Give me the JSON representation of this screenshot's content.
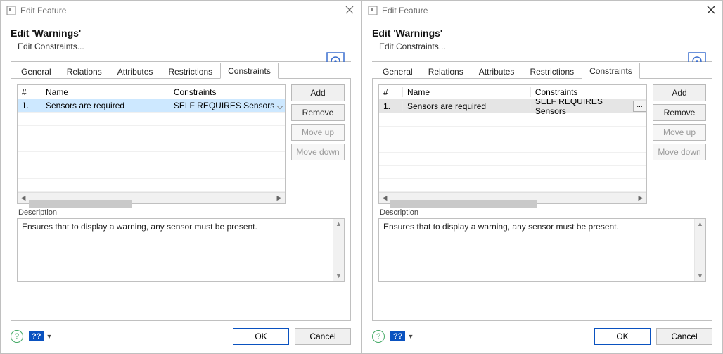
{
  "windows": [
    {
      "title": "Edit Feature",
      "heading": "Edit 'Warnings'",
      "breadcrumb": "Edit Constraints...",
      "row_selected_style": "blue",
      "show_ellipsis_in_row": false,
      "grid_thumb_width_pct": 42
    },
    {
      "title": "Edit Feature",
      "heading": "Edit 'Warnings'",
      "breadcrumb": "Edit Constraints...",
      "row_selected_style": "gray",
      "show_ellipsis_in_row": true,
      "grid_thumb_width_pct": 60
    }
  ],
  "tabs": [
    "General",
    "Relations",
    "Attributes",
    "Restrictions",
    "Constraints"
  ],
  "active_tab_index": 4,
  "columns": {
    "num": "#",
    "name": "Name",
    "constraints": "Constraints"
  },
  "rows": [
    {
      "num": "1.",
      "name": "Sensors are required",
      "constraints": "SELF REQUIRES Sensors"
    }
  ],
  "empty_row_count": 6,
  "buttons": {
    "add": "Add",
    "remove": "Remove",
    "moveup": "Move up",
    "movedown": "Move down"
  },
  "buttons_disabled": {
    "add": false,
    "remove": false,
    "moveup": true,
    "movedown": true
  },
  "description_label": "Description",
  "description_text": "Ensures that to display a warning, any sensor must be present.",
  "footer": {
    "help_badge": "??",
    "ok": "OK",
    "cancel": "Cancel"
  },
  "ellipsis_label": "..."
}
